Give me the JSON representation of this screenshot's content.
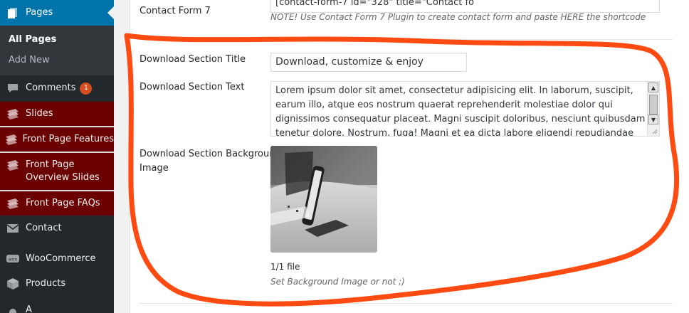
{
  "sidebar": {
    "pages": {
      "label": "Pages",
      "icon": "pages-icon"
    },
    "submenu": {
      "all_pages": "All Pages",
      "add_new": "Add New"
    },
    "comments": {
      "label": "Comments",
      "badge": "1",
      "icon": "comments-icon"
    },
    "slides": {
      "label": "Slides",
      "icon": "slides-icon"
    },
    "front_page_features": {
      "label": "Front Page Features",
      "icon": "features-icon"
    },
    "front_page_overview_slides": {
      "label_line1": "Front Page",
      "label_line2": "Overview Slides",
      "icon": "overview-icon"
    },
    "front_page_faqs": {
      "label": "Front Page FAQs",
      "icon": "faqs-icon"
    },
    "contact": {
      "label": "Contact",
      "icon": "mail-icon"
    },
    "woocommerce": {
      "label": "WooCommerce",
      "icon": "woocommerce-icon"
    },
    "products": {
      "label": "Products",
      "icon": "products-icon"
    },
    "partial_item": {
      "label": "A"
    }
  },
  "colors": {
    "active_blue": "#0073aa",
    "dark_red": "#6b0000",
    "sidebar_bg": "#23282d",
    "annotation_red": "#ff4a12"
  },
  "contact_form": {
    "label": "Contact Form 7",
    "value": "[contact-form-7 id=\"328\" title=\"Contact fo",
    "note": "NOTE! Use Contact Form 7 Plugin to create contact form and paste HERE the shortcode"
  },
  "download_title": {
    "label": "Download Section Title",
    "value": "Download, customize & enjoy"
  },
  "download_text": {
    "label": "Download Section Text",
    "value": "Lorem ipsum dolor sit amet, consectetur adipisicing elit. In laborum, suscipit, earum illo, atque eos nostrum quaerat reprehenderit molestiae dolor qui dignissimos consequatur placeat. Magni suscipit doloribus, nesciunt quibusdam tenetur dolore. Nostrum, fuga! Magni et ea dicta labore eligendi repudiandae cum quidem, non"
  },
  "download_bg": {
    "label_line1": "Download Section Background",
    "label_line2": "Image",
    "file_count": "1/1 file",
    "note": "Set Background Image or not ;)"
  }
}
